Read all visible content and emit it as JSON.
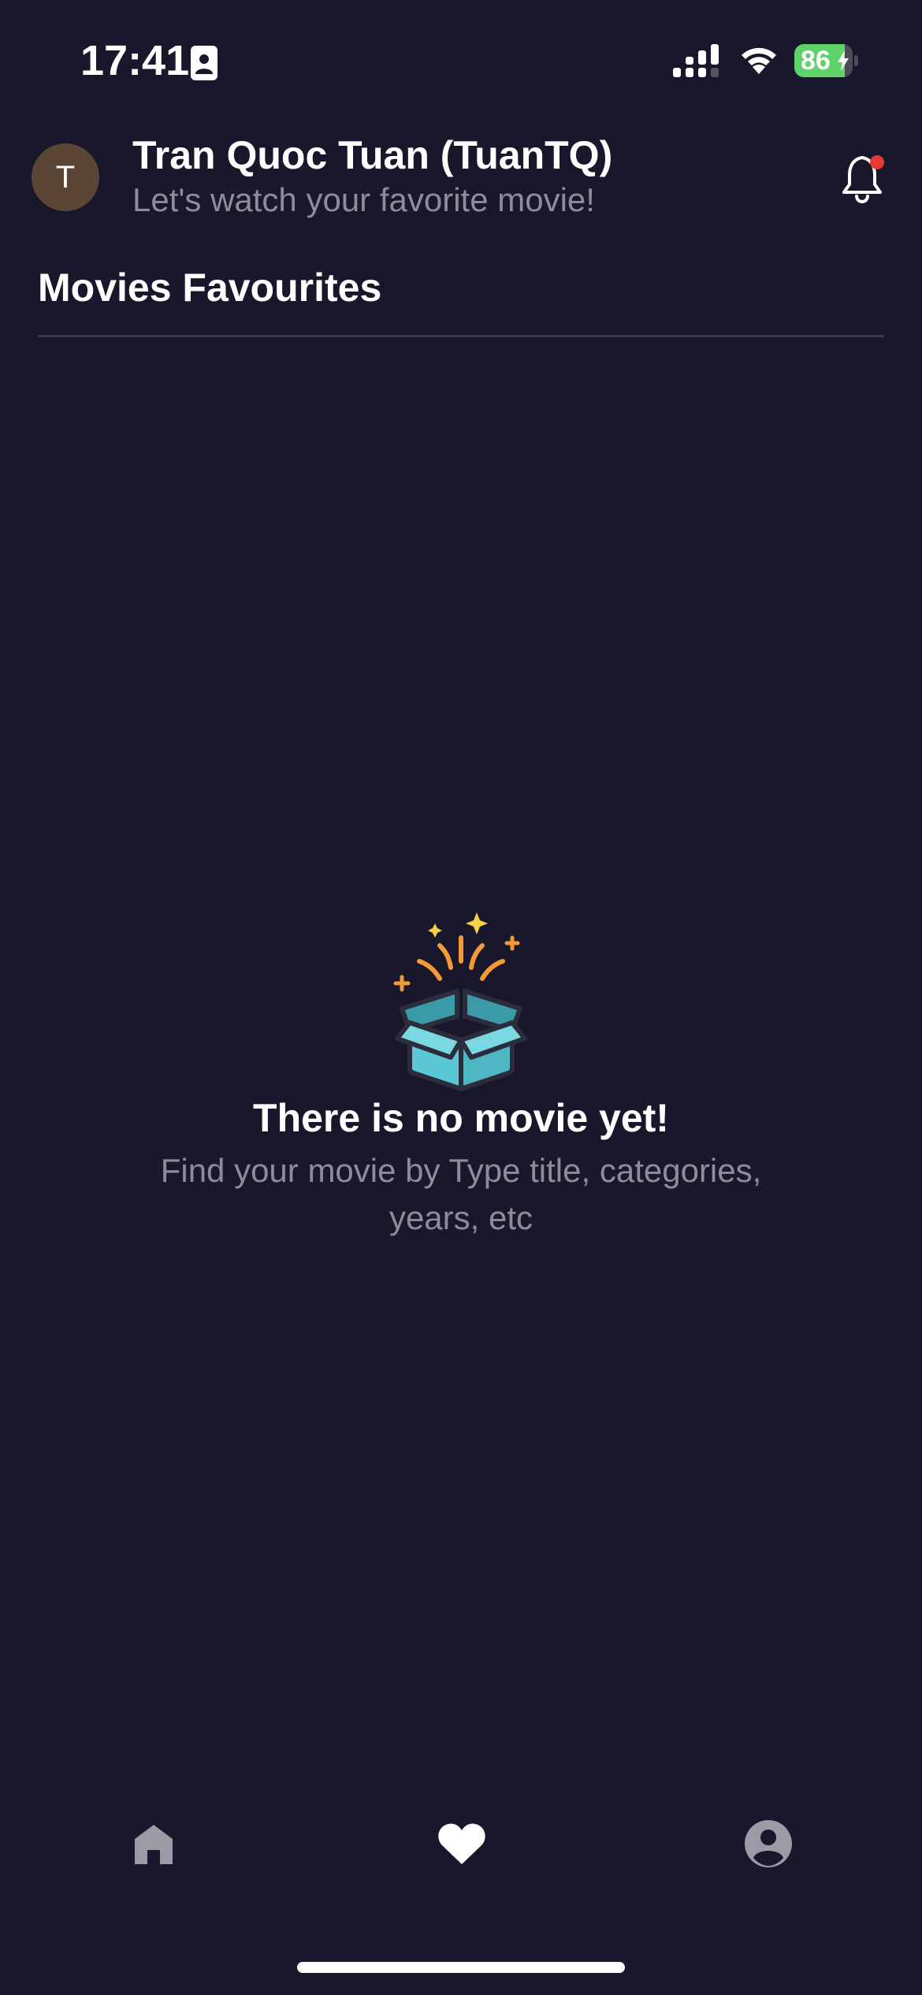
{
  "status_bar": {
    "time": "17:41",
    "battery_percent": "86",
    "battery_level": 0.86,
    "icons": [
      "contact-card-icon",
      "cellular-signal-icon",
      "wifi-icon",
      "battery-icon",
      "charging-bolt-icon"
    ]
  },
  "header": {
    "avatar_initial": "T",
    "user_name": "Tran Quoc Tuan (TuanTQ)",
    "subtitle": "Let's watch your favorite movie!",
    "notification_icon": "bell-icon",
    "has_unread_notification": true
  },
  "section": {
    "title": "Movies Favourites"
  },
  "empty_state": {
    "illustration": "open-box-icon",
    "title": "There is no movie yet!",
    "subtitle": "Find your movie by Type title, categories, years, etc"
  },
  "bottom_nav": {
    "items": [
      {
        "icon": "home-icon",
        "active": false
      },
      {
        "icon": "heart-icon",
        "active": true
      },
      {
        "icon": "profile-icon",
        "active": false
      }
    ]
  },
  "colors": {
    "background": "#18172b",
    "text_primary": "#ffffff",
    "text_secondary": "#8d8c99",
    "avatar_bg": "#5b4636",
    "notification_dot": "#e53935",
    "battery_green": "#5ed36a",
    "nav_inactive": "#9b9aa5",
    "box_cyan": "#5bc8d6",
    "box_dark": "#2c2c3a",
    "sparks_orange": "#f29a38",
    "sparks_yellow": "#f7d046"
  }
}
